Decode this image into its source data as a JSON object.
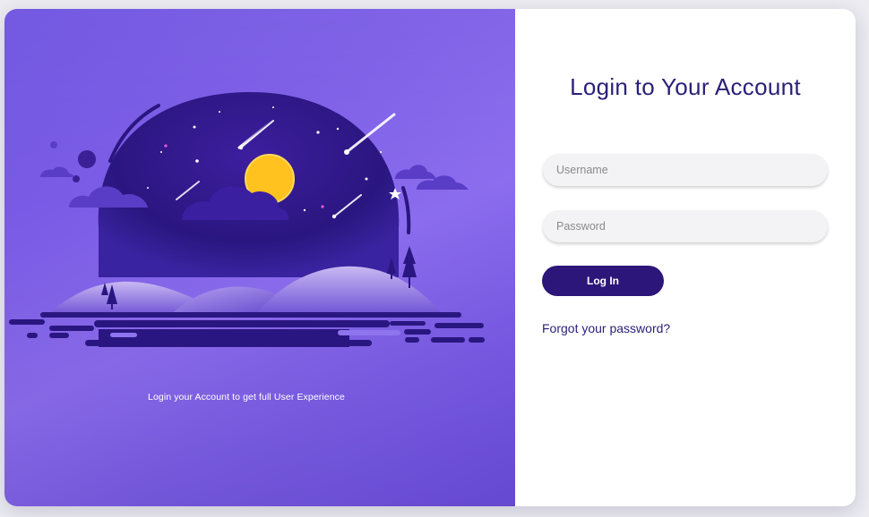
{
  "brand_panel": {
    "tagline": "Login your Account to get full User Experience"
  },
  "login_form": {
    "title": "Login to Your Account",
    "username_placeholder": "Username",
    "password_placeholder": "Password",
    "login_label": "Log In",
    "forgot_label": "Forgot your password?"
  },
  "colors": {
    "brand_purple": "#7a5be6",
    "accent_dark": "#2c1679",
    "title_text": "#2a1f78",
    "moon": "#ffc21e"
  },
  "icons": [
    "night-sky-illustration"
  ]
}
